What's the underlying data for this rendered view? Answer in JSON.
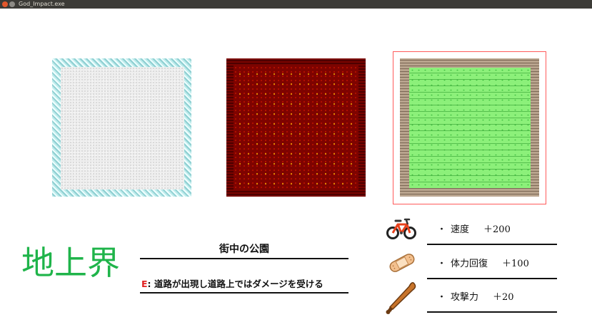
{
  "window": {
    "title": "God_Impact.exe",
    "close_color": "#e2572c"
  },
  "tiles": [
    {
      "name": "snow-tile",
      "colors": {
        "border": "#a9dcdc",
        "fill": "#eeeeee"
      },
      "selected": false
    },
    {
      "name": "lava-tile",
      "colors": {
        "border": "#6a0000",
        "fill": "#7e0300"
      },
      "selected": false
    },
    {
      "name": "park-tile",
      "colors": {
        "border": "#a08a74",
        "fill": "#8cf07a"
      },
      "selected": true
    }
  ],
  "selection_color": "#ff5a5a",
  "area": {
    "title": "地上界",
    "title_color": "#1fb44a"
  },
  "location": {
    "name": "街中の公園",
    "effect_key": "E",
    "effect_text": ": 道路が出現し道路上ではダメージを受ける",
    "effect_key_color": "#e02020"
  },
  "bonuses": [
    {
      "icon": "bicycle-icon",
      "bullet": "・",
      "label": "速度",
      "value": "＋200"
    },
    {
      "icon": "bandage-icon",
      "bullet": "・",
      "label": "体力回復",
      "value": "＋100"
    },
    {
      "icon": "bat-icon",
      "bullet": "・",
      "label": "攻撃力",
      "value": "＋20"
    }
  ]
}
